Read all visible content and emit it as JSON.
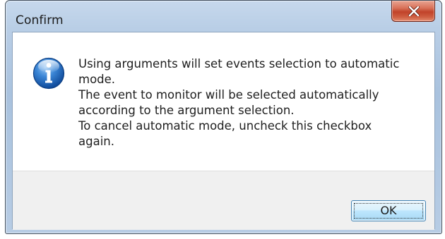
{
  "window": {
    "title": "Confirm"
  },
  "message": {
    "lines": [
      "Using arguments will set events selection to automatic",
      "mode.",
      "The event to monitor will be selected automatically",
      "according to the argument selection.",
      "To cancel automatic mode, uncheck this checkbox",
      "again."
    ]
  },
  "buttons": {
    "ok_label": "OK"
  },
  "icons": {
    "message_icon": "information-icon",
    "close_icon": "close-x-icon"
  },
  "colors": {
    "close_button": "#c1432a",
    "info_icon": "#1a63b8",
    "ok_button_border": "#3c7fb1"
  }
}
